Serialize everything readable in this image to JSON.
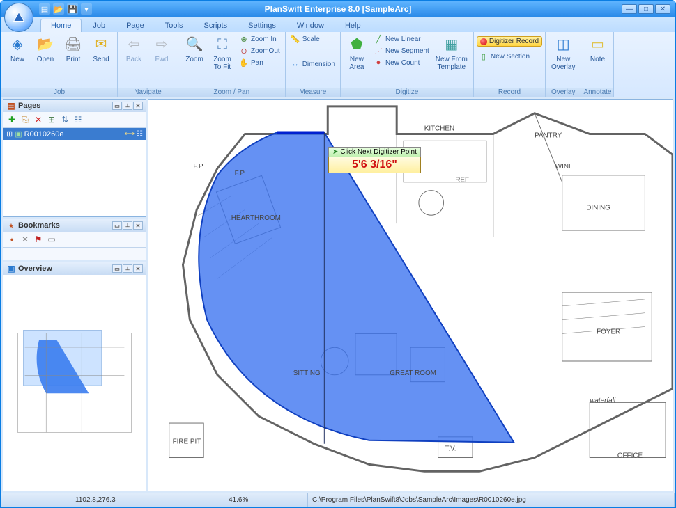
{
  "app_title": "PlanSwift Enterprise 8.0   [SampleArc]",
  "qat": {
    "new": "▤",
    "open": "📂",
    "save": "💾",
    "more": "▾"
  },
  "tabs": [
    "Home",
    "Job",
    "Page",
    "Tools",
    "Scripts",
    "Settings",
    "Window",
    "Help"
  ],
  "active_tab": 0,
  "ribbon": {
    "job": {
      "label": "Job",
      "new": "New",
      "open": "Open",
      "print": "Print",
      "send": "Send"
    },
    "navigate": {
      "label": "Navigate",
      "back": "Back",
      "fwd": "Fwd"
    },
    "zoompan": {
      "label": "Zoom / Pan",
      "zoom": "Zoom",
      "zoom_to_fit": "Zoom\nTo Fit",
      "zoom_in": "Zoom In",
      "zoom_out": "ZoomOut",
      "pan": "Pan"
    },
    "measure": {
      "label": "Measure",
      "scale": "Scale",
      "dimension": "Dimension"
    },
    "digitize": {
      "label": "Digitize",
      "new_area": "New\nArea",
      "new_linear": "New Linear",
      "new_segment": "New Segment",
      "new_count": "New Count",
      "new_from_template": "New From\nTemplate"
    },
    "record": {
      "label": "Record",
      "digitizer_record": "Digitizer Record",
      "new_section": "New Section"
    },
    "overlay": {
      "label": "Overlay",
      "new_overlay": "New\nOverlay"
    },
    "annotate": {
      "label": "Annotate",
      "note": "Note"
    }
  },
  "panels": {
    "pages": {
      "title": "Pages",
      "item": "R0010260e"
    },
    "bookmarks": {
      "title": "Bookmarks"
    },
    "overview": {
      "title": "Overview"
    }
  },
  "measurement": {
    "hint": "Click Next Digitizer Point",
    "value": "5'6 3/16\""
  },
  "floorplan_labels": {
    "kitchen": "KITCHEN",
    "pantry": "PANTRY",
    "dining": "DINING",
    "hearthroom": "HEARTHROOM",
    "sitting": "SITTING",
    "greatroom": "GREAT ROOM",
    "foyer": "FOYER",
    "office": "OFFICE",
    "waterfall": "waterfall",
    "fp1": "F.P",
    "fp2": "F.P",
    "firepit": "FIRE\nPIT",
    "tv": "T.V.",
    "wine": "WINE",
    "ref": "REF"
  },
  "status": {
    "coords": "1102.8,276.3",
    "zoom": "41.6%",
    "path": "C:\\Program Files\\PlanSwift8\\Jobs\\SampleArc\\Images\\R0010260e.jpg"
  }
}
